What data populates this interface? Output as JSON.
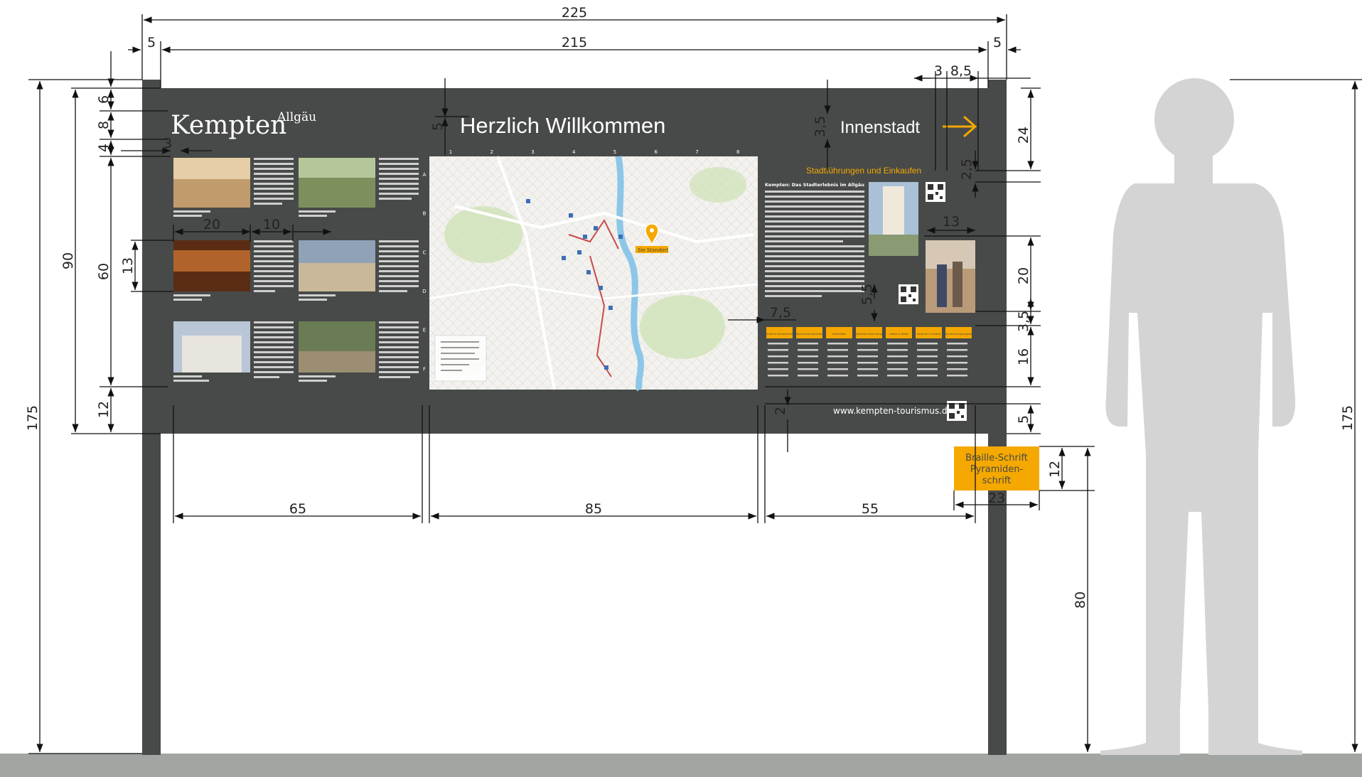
{
  "dimensions": {
    "total_width": "225",
    "inner_width": "215",
    "post_left": "5",
    "post_right": "5",
    "top_right_a": "3",
    "top_right_b": "8,5",
    "left_6": "6",
    "left_8": "8",
    "left_4": "4",
    "left_3": "3",
    "left_90": "90",
    "left_60": "60",
    "left_12": "12",
    "left_175": "175",
    "photo_20": "20",
    "photo_10": "10",
    "photo_13": "13",
    "title_5": "5",
    "innen_35": "3,5",
    "right_24": "24",
    "right_25": "2,5",
    "qr_13": "13",
    "right_20": "20",
    "right_55v": "5,5",
    "right_75": "7,5",
    "right_35b": "3,5",
    "right_16": "16",
    "right_2": "2",
    "right_5": "5",
    "col_65": "65",
    "col_85": "85",
    "col_55": "55",
    "braille_12": "12",
    "braille_23": "23",
    "height_80": "80",
    "person_175": "175"
  },
  "board": {
    "logo_main": "Kempten",
    "logo_sup": "Allgäu",
    "title": "Herzlich Willkommen",
    "direction": "Innenstadt",
    "subtitle": "Stadtführungen und Einkaufen",
    "website": "www.kempten-tourismus.de",
    "map_label": "Sie Standort",
    "map_cols": [
      "1",
      "2",
      "3",
      "4",
      "5",
      "6",
      "7",
      "8"
    ],
    "map_rows": [
      "A",
      "B",
      "C",
      "D",
      "E",
      "F"
    ],
    "intro_heading": "Kempten: Das Stadterlebnis im Allgäu",
    "categories": [
      "Öffentliche Verkehrsmittel",
      "Sehenswürdig-keiten",
      "Kulturelles",
      "Öffentliche Einrichtungen",
      "Hotels & Gäste",
      "Museum & Freizeit",
      "Übernachtungsangebote"
    ]
  },
  "braille": {
    "line1": "Braille-Schrift",
    "line2": "Pyramiden-",
    "line3": "schrift"
  },
  "colors": {
    "board": "#474a48",
    "accent": "#f5a800",
    "ground": "#a2a6a3",
    "person": "#d4d4d4"
  }
}
